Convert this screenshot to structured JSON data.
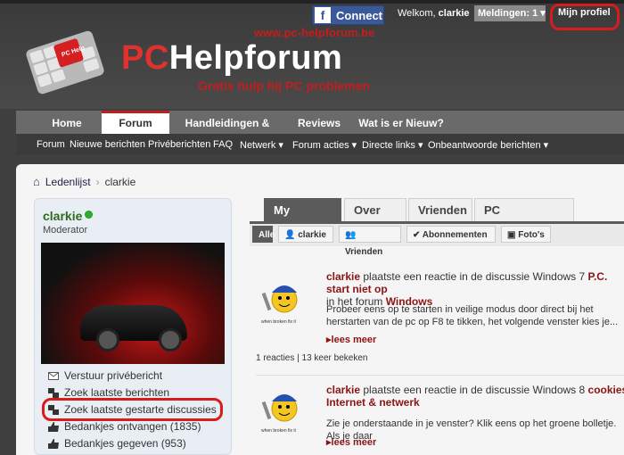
{
  "header": {
    "facebook_label": "Connect",
    "welcome_label": "Welkom,",
    "username": "clarkie",
    "notifications_label": "Meldingen: 1",
    "profile_label": "Mijn profiel",
    "site_url": "www.pc-helpforum.be",
    "brand_pc": "PC",
    "brand_rest": "Helpforum",
    "tagline": "Gratis hulp bij PC problemen",
    "logo_key_text": "PC Help"
  },
  "nav": {
    "tabs": [
      "Home",
      "Forum",
      "Handleidingen & Tips",
      "Reviews",
      "Wat is er Nieuw?"
    ],
    "sub": [
      "Forum",
      "Nieuwe berichten",
      "Privéberichten",
      "FAQ",
      "Netwerk ▾",
      "Forum acties ▾",
      "Directe links ▾",
      "Onbeantwoorde berichten ▾"
    ]
  },
  "breadcrumb": {
    "link": "Ledenlijst",
    "current": "clarkie"
  },
  "profile": {
    "name": "clarkie",
    "role": "Moderator",
    "links": [
      "Verstuur privébericht",
      "Zoek laatste berichten",
      "Zoek laatste gestarte discussies",
      "Bedankjes ontvangen (1835)",
      "Bedankjes gegeven (953)"
    ]
  },
  "tabs": [
    "My Activity",
    "Over mij",
    "Vrienden",
    "PC Specificaties"
  ],
  "filters": [
    "Alle",
    "clarkie",
    "Vrienden",
    "Abonnementen",
    "Foto's"
  ],
  "activity": [
    {
      "user": "clarkie",
      "action": " plaatste een reactie in de discussie Windows 7 ",
      "topic": "P.C. start niet op",
      "forum_prefix": "in het forum ",
      "forum": "Windows",
      "excerpt": "Probeer eens op te starten in veilige modus door direct bij het herstarten van de pc op F8 te tikken, het volgende venster kies je...",
      "more": "lees meer",
      "meta": "1 reacties | 13 keer bekeken",
      "avatar_caption": "when broken fix it"
    },
    {
      "user": "clarkie",
      "action": " plaatste een reactie in de discussie Windows 8 ",
      "topic": "cookies",
      "forum_prefix": "",
      "forum": "Internet & netwerk",
      "excerpt": "Zie je onderstaande in je venster? Klik eens op het groene bolletje. Als je daar",
      "more": "lees meer",
      "avatar_caption": "when broken fix it"
    }
  ],
  "colors": {
    "accent_red": "#c41d1d",
    "facebook": "#3b5998",
    "username_green": "#2e6b1f"
  }
}
